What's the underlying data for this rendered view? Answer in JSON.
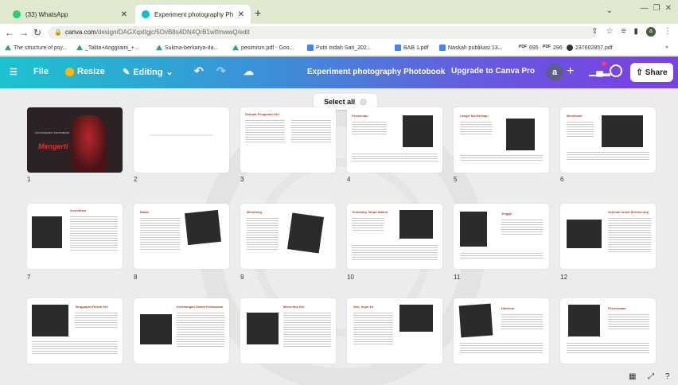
{
  "browser": {
    "tabs": [
      {
        "label": "(33) WhatsApp",
        "active": false
      },
      {
        "label": "Experiment photography Photob",
        "active": true
      }
    ],
    "new_tab": "+",
    "url_host": "canva.com",
    "url_path": "/design/DAGXqxlIgjc/5OvB8s4DN4QrB1wIfmwwQ/edit",
    "bookmarks": [
      {
        "label": "The structure of psy...",
        "icon": "drive"
      },
      {
        "label": "_Talita+Anggraini_+...",
        "icon": "drive"
      },
      {
        "label": "Sukma-berkarya-da...",
        "icon": "drive"
      },
      {
        "label": "pesimism.pdf - Goo...",
        "icon": "drive"
      },
      {
        "label": "Putri Indah Sari_202...",
        "icon": "doc"
      },
      {
        "label": "BAB 1.pdf",
        "icon": "doc"
      },
      {
        "label": "Naskah publikasi 13...",
        "icon": "doc"
      },
      {
        "label": "695",
        "icon": "pdf",
        "prefix": "PDF"
      },
      {
        "label": "296",
        "icon": "pdf",
        "prefix": "PDF"
      },
      {
        "label": "237602857.pdf",
        "icon": "chrome"
      }
    ],
    "profile_initial": "a"
  },
  "toolbar": {
    "menu": "☰",
    "file": "File",
    "resize": "Resize",
    "editing": "Editing",
    "undo": "↶",
    "redo": "↷",
    "cloud": "☁",
    "title": "Experiment photography Photobook",
    "upgrade": "Upgrade to Canva Pro",
    "avatar": "a",
    "plus": "+",
    "share": "Share"
  },
  "canvas": {
    "select_all": "Select all",
    "pages": [
      {
        "num": "1",
        "type": "cover",
        "title": "Mengerti",
        "sub": "PHOTOGRAPHY PHOTOBOOK"
      },
      {
        "num": "2",
        "type": "blank"
      },
      {
        "num": "3",
        "type": "text",
        "title": "Sebuah Pengantar Diri"
      },
      {
        "num": "4",
        "type": "photo",
        "title": "Pertemuan"
      },
      {
        "num": "5",
        "type": "photo",
        "title": "Langit Tak Berhaju"
      },
      {
        "num": "6",
        "type": "photo",
        "title": "Menikmati"
      },
      {
        "num": "7",
        "type": "photo",
        "title": "Kesedihan"
      },
      {
        "num": "8",
        "type": "photo",
        "title": "Bakal"
      },
      {
        "num": "9",
        "type": "photo",
        "title": "Menolong"
      },
      {
        "num": "10",
        "type": "photo",
        "title": "Terhalang Tanpa Makna"
      },
      {
        "num": "11",
        "type": "photo",
        "title": "Jingga"
      },
      {
        "num": "12",
        "type": "photo",
        "title": "Sejenak Untuk Bermenung"
      },
      {
        "num": "",
        "type": "photo",
        "title": "Tanggapan Resah Diri"
      },
      {
        "num": "",
        "type": "photo",
        "title": "Ketenangan Dalam Kekacauan"
      },
      {
        "num": "",
        "type": "photo",
        "title": "Menerima Diri"
      },
      {
        "num": "",
        "type": "photo",
        "title": "Aku, Ingin Ini"
      },
      {
        "num": "",
        "type": "photo",
        "title": "Diterima"
      },
      {
        "num": "",
        "type": "photo",
        "title": "Penerimaan"
      }
    ]
  },
  "colors": {
    "toolbar_start": "#1cc3cf",
    "toolbar_end": "#7b3fe4",
    "page_title": "#b8411f",
    "canvas_bg": "#ebecee"
  }
}
